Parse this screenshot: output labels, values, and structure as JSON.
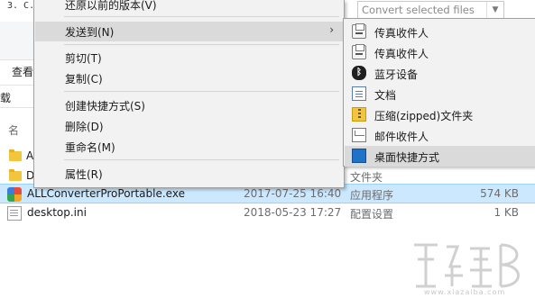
{
  "background": {
    "path_fragment": "3. C.",
    "convert_select": {
      "value": "Convert selected files"
    },
    "ribbon_view_label": "查看",
    "address_fragment": "载",
    "column_header_fragment": "名",
    "folders": [
      {
        "letter": "A"
      },
      {
        "letter": "D"
      }
    ],
    "partial_type_text": "文件夹"
  },
  "context_menu": {
    "items": [
      {
        "label": "还原以前的版本(V)"
      },
      {
        "label": "发送到(N)",
        "highlighted": true,
        "has_submenu": true
      },
      {
        "label": "剪切(T)"
      },
      {
        "label": "复制(C)"
      },
      {
        "label": "创建快捷方式(S)"
      },
      {
        "label": "删除(D)"
      },
      {
        "label": "重命名(M)"
      },
      {
        "label": "属性(R)"
      }
    ],
    "submenu_chevron": "›"
  },
  "send_to_submenu": {
    "items": [
      {
        "label": "传真收件人",
        "icon": "fax-icon"
      },
      {
        "label": "传真收件人",
        "icon": "fax-icon"
      },
      {
        "label": "蓝牙设备",
        "icon": "bluetooth-icon"
      },
      {
        "label": "文档",
        "icon": "document-icon"
      },
      {
        "label": "压缩(zipped)文件夹",
        "icon": "zip-folder-icon"
      },
      {
        "label": "邮件收件人",
        "icon": "mail-icon"
      },
      {
        "label": "桌面快捷方式",
        "icon": "desktop-icon",
        "highlighted": true
      }
    ]
  },
  "files": [
    {
      "name": "ALLConverterProPortable.exe",
      "date": "2017-07-25 16:40",
      "type": "应用程序",
      "size": "574 KB",
      "selected": true
    },
    {
      "name": "desktop.ini",
      "date": "2018-05-23 17:27",
      "type": "配置设置",
      "size": "1 KB",
      "selected": false
    }
  ],
  "watermark": {
    "domain": "www.xiazaiba.com"
  },
  "colors": {
    "menu_bg": "#f2f2f2",
    "menu_highlight": "#dadada",
    "selection_bg": "#cce8ff",
    "selection_border": "#99d1ff"
  }
}
